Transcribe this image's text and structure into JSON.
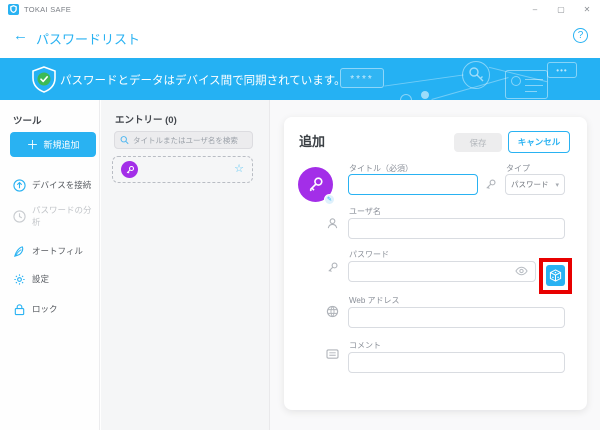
{
  "window": {
    "title": "TOKAI SAFE",
    "minimize": "–",
    "maximize": "▢",
    "close": "✕"
  },
  "header": {
    "back": "←",
    "title": "パスワードリスト",
    "help": "?"
  },
  "banner": {
    "text": "パスワードとデータはデバイス間で同期されています。",
    "stars": "****",
    "dots": "•••"
  },
  "sidebar": {
    "heading": "ツール",
    "new_button": {
      "plus": "＋",
      "label": "新規追加"
    },
    "items": [
      {
        "label": "デバイスを接続"
      },
      {
        "label": "パスワードの分析"
      },
      {
        "label": "オートフィル"
      },
      {
        "label": "設定"
      },
      {
        "label": "ロック"
      }
    ]
  },
  "entries": {
    "heading": "エントリー (0)",
    "search_placeholder": "タイトルまたはユーザ名を検索"
  },
  "form": {
    "title": "追加",
    "save_label": "保存",
    "cancel_label": "キャンセル",
    "title_label": "タイトル（必須）",
    "title_value": "",
    "type_label": "タイプ",
    "type_value": "パスワード",
    "username_label": "ユーザ名",
    "username_value": "",
    "password_label": "パスワード",
    "password_value": "",
    "web_label": "Web アドレス",
    "web_value": "",
    "comment_label": "コメント",
    "comment_value": ""
  },
  "colors": {
    "accent": "#29b2f2",
    "purple": "#a32ee8",
    "annotation_red": "#e80000",
    "check_green": "#3cba54"
  }
}
